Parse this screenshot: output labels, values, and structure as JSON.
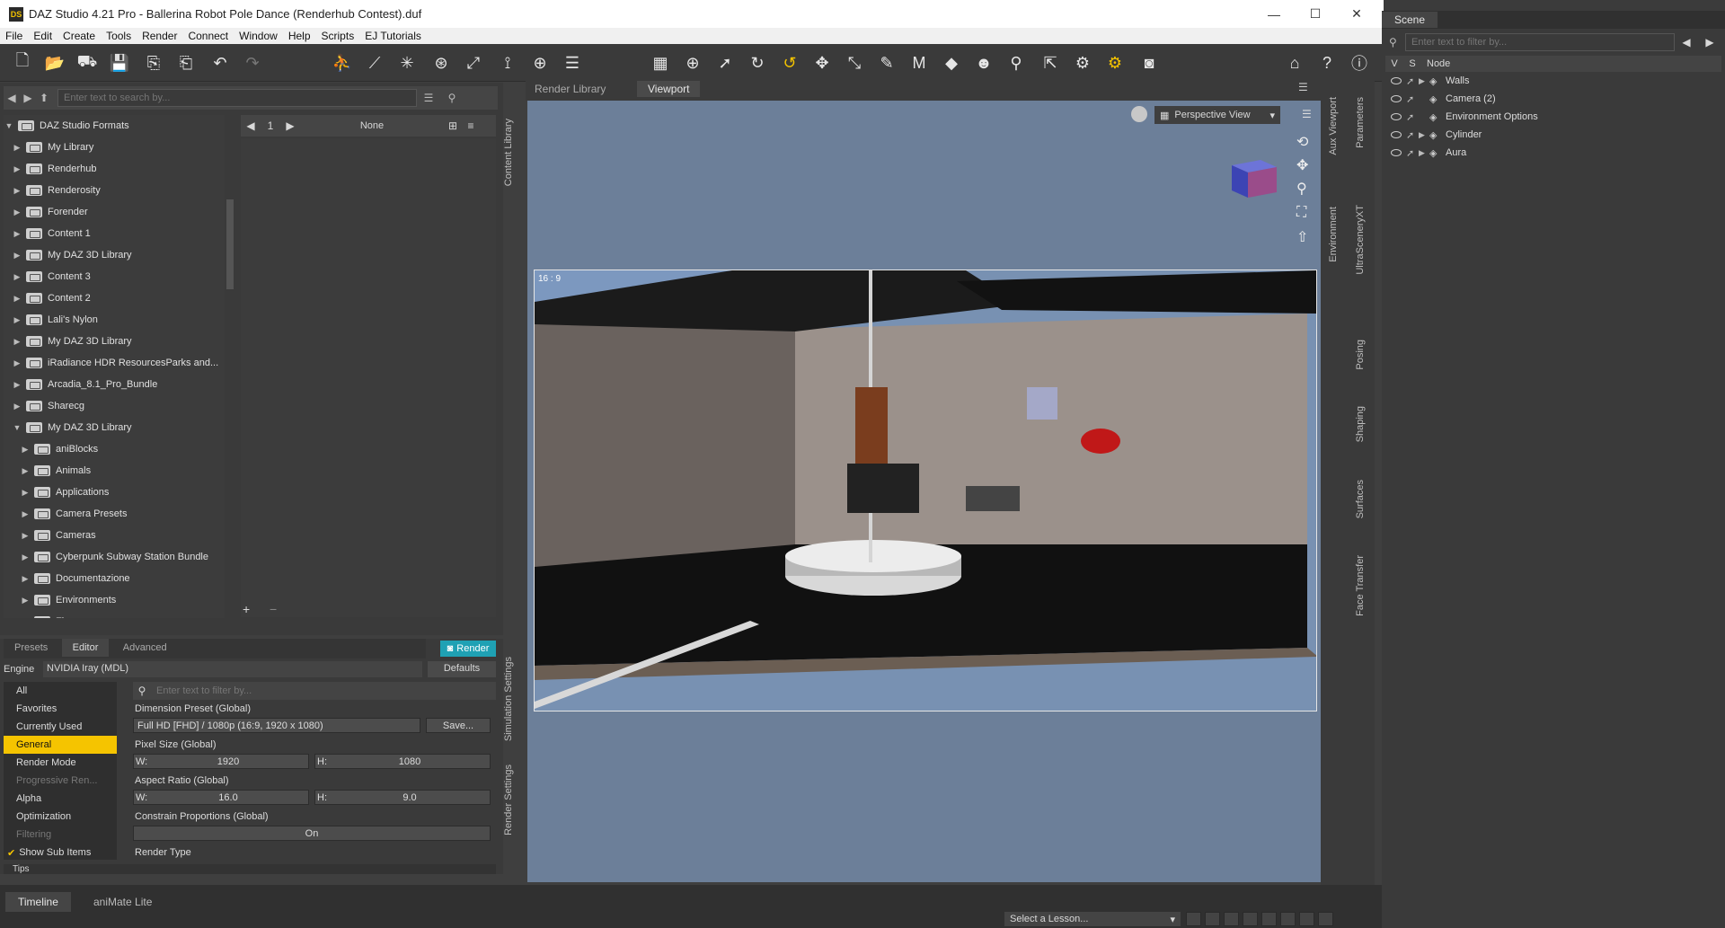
{
  "window": {
    "title": "DAZ Studio 4.21 Pro - Ballerina Robot Pole Dance (Renderhub Contest).duf",
    "minimize": "—",
    "maximize": "☐",
    "close": "✕"
  },
  "menu": [
    "File",
    "Edit",
    "Create",
    "Tools",
    "Render",
    "Connect",
    "Window",
    "Help",
    "Scripts",
    "EJ Tutorials"
  ],
  "content_library": {
    "search_placeholder": "Enter text to search by...",
    "page_number": "1",
    "filter_value": "None",
    "tree": [
      {
        "label": "DAZ Studio Formats",
        "expanded": true,
        "depth": 0
      },
      {
        "label": "My Library",
        "depth": 1
      },
      {
        "label": "Renderhub",
        "depth": 1
      },
      {
        "label": "Renderosity",
        "depth": 1
      },
      {
        "label": "Forender",
        "depth": 1
      },
      {
        "label": "Content 1",
        "depth": 1
      },
      {
        "label": "My DAZ 3D Library",
        "depth": 1
      },
      {
        "label": "Content 3",
        "depth": 1
      },
      {
        "label": "Content 2",
        "depth": 1
      },
      {
        "label": "Lali's Nylon",
        "depth": 1
      },
      {
        "label": "My DAZ 3D Library",
        "depth": 1
      },
      {
        "label": "iRadiance HDR ResourcesParks and...",
        "depth": 1
      },
      {
        "label": "Arcadia_8.1_Pro_Bundle",
        "depth": 1
      },
      {
        "label": "Sharecg",
        "depth": 1
      },
      {
        "label": "My DAZ 3D Library",
        "expanded": true,
        "depth": 1
      },
      {
        "label": "aniBlocks",
        "depth": 2
      },
      {
        "label": "Animals",
        "depth": 2
      },
      {
        "label": "Applications",
        "depth": 2
      },
      {
        "label": "Camera Presets",
        "depth": 2
      },
      {
        "label": "Cameras",
        "depth": 2
      },
      {
        "label": "Cyberpunk Subway Station Bundle",
        "depth": 2
      },
      {
        "label": "Documentazione",
        "depth": 2
      },
      {
        "label": "Environments",
        "depth": 2
      },
      {
        "label": "Figures",
        "depth": 2
      }
    ],
    "vtab": "Content Library"
  },
  "render_settings": {
    "tabs": [
      "Presets",
      "Editor",
      "Advanced"
    ],
    "render_button": "Render",
    "engine_label": "Engine",
    "engine_value": "NVIDIA Iray (MDL)",
    "defaults_button": "Defaults",
    "filter_placeholder": "Enter text to filter by...",
    "categories": [
      "All",
      "Favorites",
      "Currently Used",
      "General",
      "Render Mode",
      "Progressive Ren...",
      "Alpha",
      "Optimization",
      "Filtering"
    ],
    "selected_category": "General",
    "show_sub_items": "Show Sub Items",
    "dimension_preset_label": "Dimension Preset (Global)",
    "dimension_preset_value": "Full HD [FHD] / 1080p (16:9, 1920 x 1080)",
    "save_button": "Save...",
    "pixel_size_label": "Pixel Size (Global)",
    "pixel_w_label": "W:",
    "pixel_w": "1920",
    "pixel_h_label": "H:",
    "pixel_h": "1080",
    "aspect_label": "Aspect Ratio (Global)",
    "aspect_w_label": "W:",
    "aspect_w": "16.0",
    "aspect_h_label": "H:",
    "aspect_h": "9.0",
    "constrain_label": "Constrain Proportions (Global)",
    "constrain_value": "On",
    "render_type_label": "Render Type",
    "tips_tab": "Tips",
    "vtab_render_settings": "Render Settings",
    "vtab_simulation": "Simulation Settings"
  },
  "viewport": {
    "tabs": [
      "Render Library",
      "Viewport"
    ],
    "active_tab": "Viewport",
    "view_mode": "Perspective View",
    "aspect_badge": "16 : 9"
  },
  "right_tabs": [
    "Aux Viewport",
    "Parameters",
    "Environment",
    "UltraSceneryXT",
    "Posing",
    "Shaping",
    "Surfaces",
    "Face Transfer"
  ],
  "scene": {
    "title": "Scene",
    "filter_placeholder": "Enter text to filter by...",
    "col_v": "V",
    "col_s": "S",
    "col_node": "Node",
    "nodes": [
      "Walls",
      "Camera (2)",
      "Environment Options",
      "Cylinder",
      "Aura"
    ]
  },
  "bottom": {
    "timeline_tab": "Timeline",
    "animate_tab": "aniMate Lite",
    "lesson_select": "Select a Lesson..."
  }
}
